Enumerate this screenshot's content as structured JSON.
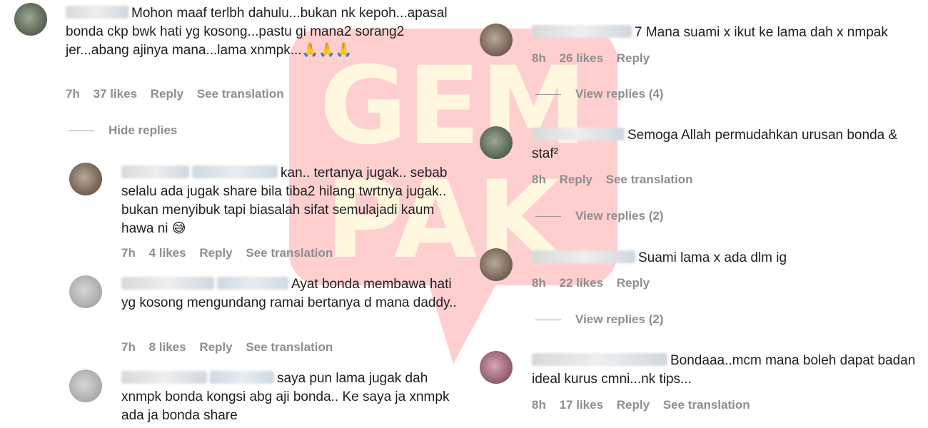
{
  "watermark": {
    "text_top": "GEM",
    "text_bottom": "PAK",
    "color": "#ff2a2a"
  },
  "left": {
    "c1": {
      "text": "Mohon maaf terlbh dahulu...bukan nk kepoh...apasal bonda ckp bwk hati yg kosong...pastu gi mana2 sorang2 jer...abang ajinya mana...lama xnmpk...🙏🙏🙏",
      "time": "7h",
      "likes": "37 likes",
      "reply": "Reply",
      "translation": "See translation",
      "hide_replies": "Hide replies"
    },
    "c2": {
      "text": "kan.. tertanya jugak.. sebab selalu ada jugak share bila tiba2 hilang twrtnya jugak.. bukan menyibuk tapi biasalah sifat semulajadi kaum hawa ni 😅",
      "time": "7h",
      "likes": "4 likes",
      "reply": "Reply",
      "translation": "See translation"
    },
    "c3": {
      "text": "Ayat bonda membawa hati yg kosong mengundang ramai bertanya d mana daddy..",
      "time": "7h",
      "likes": "8 likes",
      "reply": "Reply",
      "translation": "See translation"
    },
    "c4": {
      "text": "saya pun lama jugak dah xnmpk bonda kongsi abg aji bonda.. Ke saya ja xnmpk ada ja bonda share"
    }
  },
  "right": {
    "c1": {
      "text": "7 Mana suami x ikut ke lama dah x nmpak",
      "time": "8h",
      "likes": "26 likes",
      "reply": "Reply",
      "view_replies": "View replies (4)"
    },
    "c2": {
      "text": "Semoga Allah permudahkan urusan bonda & staf²",
      "time": "8h",
      "reply": "Reply",
      "translation": "See translation",
      "view_replies": "View replies (2)"
    },
    "c3": {
      "text": "Suami lama x ada dlm ig",
      "time": "8h",
      "likes": "22 likes",
      "reply": "Reply",
      "view_replies": "View replies (2)"
    },
    "c4": {
      "text": "Bondaaa..mcm mana boleh dapat badan ideal kurus cmni...nk tips...",
      "time": "8h",
      "likes": "17 likes",
      "reply": "Reply",
      "translation": "See translation"
    }
  }
}
